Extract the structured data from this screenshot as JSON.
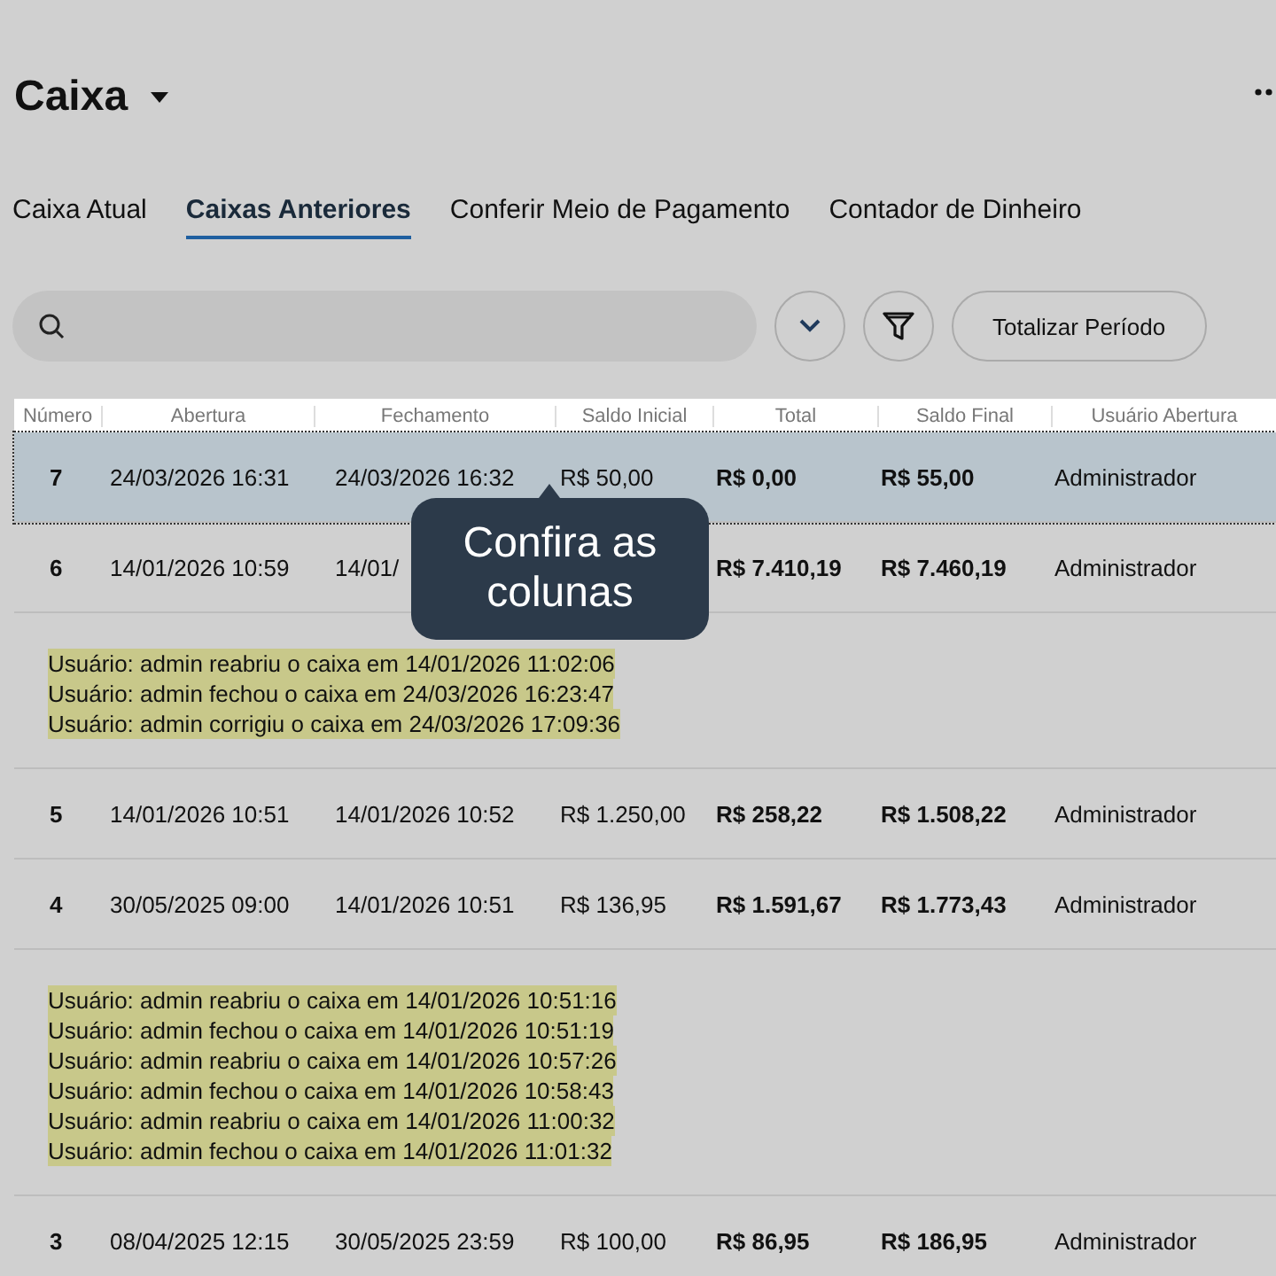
{
  "title": "Caixa",
  "tabs": [
    {
      "label": "Caixa Atual",
      "selected": false
    },
    {
      "label": "Caixas Anteriores",
      "selected": true
    },
    {
      "label": "Conferir Meio de Pagamento",
      "selected": false
    },
    {
      "label": "Contador de Dinheiro",
      "selected": false
    }
  ],
  "toolbar": {
    "total_button": "Totalizar Período"
  },
  "table": {
    "columns": [
      "Número",
      "Abertura",
      "Fechamento",
      "Saldo Inicial",
      "Total",
      "Saldo Final",
      "Usuário Abertura"
    ],
    "rows": [
      {
        "cells": [
          "7",
          "24/03/2026 16:31",
          "24/03/2026 16:32",
          "R$ 50,00",
          "R$ 0,00",
          "R$ 55,00",
          "Administrador"
        ],
        "selected": true
      },
      {
        "cells": [
          "6",
          "14/01/2026 10:59",
          "14/01/",
          "",
          "R$ 7.410,19",
          "R$ 7.460,19",
          "Administrador"
        ],
        "selected": false,
        "log": [
          "Usuário: admin reabriu o caixa em 14/01/2026 11:02:06",
          "Usuário: admin fechou o caixa em 24/03/2026 16:23:47",
          "Usuário: admin corrigiu o caixa em 24/03/2026 17:09:36"
        ]
      },
      {
        "cells": [
          "5",
          "14/01/2026 10:51",
          "14/01/2026 10:52",
          "R$ 1.250,00",
          "R$ 258,22",
          "R$ 1.508,22",
          "Administrador"
        ],
        "selected": false
      },
      {
        "cells": [
          "4",
          "30/05/2025 09:00",
          "14/01/2026 10:51",
          "R$ 136,95",
          "R$ 1.591,67",
          "R$ 1.773,43",
          "Administrador"
        ],
        "selected": false,
        "log": [
          "Usuário: admin reabriu o caixa em 14/01/2026 10:51:16",
          "Usuário: admin fechou o caixa em 14/01/2026 10:51:19",
          "Usuário: admin reabriu o caixa em 14/01/2026 10:57:26",
          "Usuário: admin fechou o caixa em 14/01/2026 10:58:43",
          "Usuário: admin reabriu o caixa em 14/01/2026 11:00:32",
          "Usuário: admin fechou o caixa em 14/01/2026 11:01:32"
        ]
      },
      {
        "cells": [
          "3",
          "08/04/2025 12:15",
          "30/05/2025 23:59",
          "R$ 100,00",
          "R$ 86,95",
          "R$ 186,95",
          "Administrador"
        ],
        "selected": false
      }
    ]
  },
  "tooltip": "Confira as colunas"
}
